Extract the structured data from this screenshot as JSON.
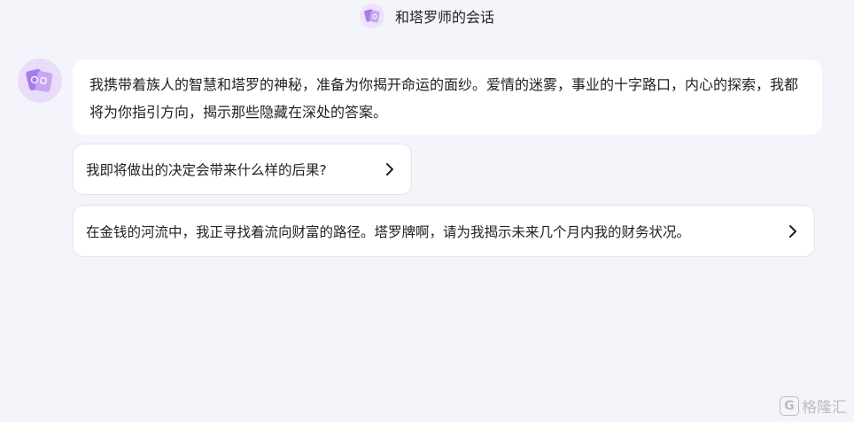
{
  "header": {
    "title": "和塔罗师的会话",
    "avatar_icon": "tarot-cards-icon"
  },
  "conversation": {
    "bot_avatar_icon": "tarot-cards-icon",
    "greeting": "我携带着族人的智慧和塔罗的神秘，准备为你揭开命运的面纱。爱情的迷雾，事业的十字路口，内心的探索，我都将为你指引方向，揭示那些隐藏在深处的答案。"
  },
  "suggestions": [
    {
      "text": "我即将做出的决定会带来什么样的后果?",
      "icon": "chevron-right-icon"
    },
    {
      "text": "在金钱的河流中，我正寻找着流向财富的路径。塔罗牌啊，请为我揭示未来几个月内我的财务状况。",
      "icon": "chevron-right-icon"
    }
  ],
  "watermark": {
    "logo_letter": "G",
    "text": "格隆汇"
  },
  "colors": {
    "background": "#f4f5fa",
    "avatar_bg": "#eadcfb",
    "card_front": "#c9a6f2",
    "card_back": "#a67de8",
    "border": "#e2e4ea"
  }
}
